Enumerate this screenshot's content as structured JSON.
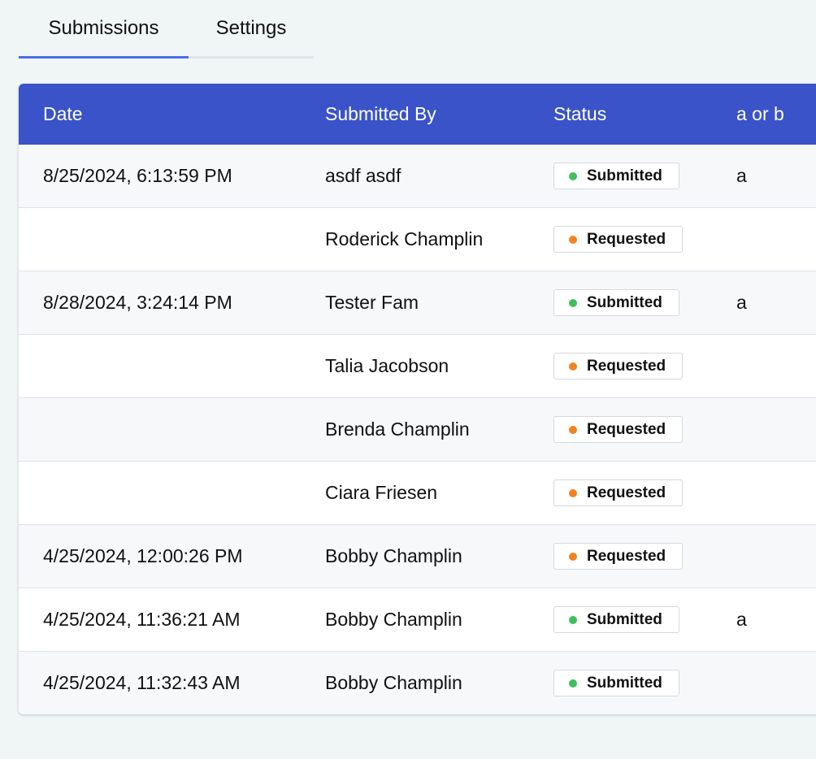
{
  "tabs": [
    {
      "label": "Submissions",
      "active": true
    },
    {
      "label": "Settings",
      "active": false
    }
  ],
  "table": {
    "columns": [
      "Date",
      "Submitted By",
      "Status",
      "a or b"
    ],
    "status_colors": {
      "Submitted": "#3fbf5a",
      "Requested": "#f58220"
    },
    "rows": [
      {
        "date": "8/25/2024, 6:13:59 PM",
        "by": "asdf asdf",
        "status": "Submitted",
        "ab": "a"
      },
      {
        "date": "",
        "by": "Roderick Champlin",
        "status": "Requested",
        "ab": ""
      },
      {
        "date": "8/28/2024, 3:24:14 PM",
        "by": "Tester Fam",
        "status": "Submitted",
        "ab": "a"
      },
      {
        "date": "",
        "by": "Talia Jacobson",
        "status": "Requested",
        "ab": ""
      },
      {
        "date": "",
        "by": "Brenda Champlin",
        "status": "Requested",
        "ab": ""
      },
      {
        "date": "",
        "by": "Ciara Friesen",
        "status": "Requested",
        "ab": ""
      },
      {
        "date": "4/25/2024, 12:00:26 PM",
        "by": "Bobby Champlin",
        "status": "Requested",
        "ab": ""
      },
      {
        "date": "4/25/2024, 11:36:21 AM",
        "by": "Bobby Champlin",
        "status": "Submitted",
        "ab": "a"
      },
      {
        "date": "4/25/2024, 11:32:43 AM",
        "by": "Bobby Champlin",
        "status": "Submitted",
        "ab": ""
      }
    ]
  }
}
